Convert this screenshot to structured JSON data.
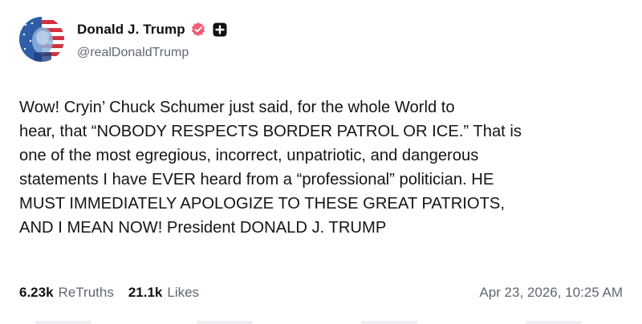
{
  "author": {
    "display_name": "Donald J. Trump",
    "handle": "@realDonaldTrump",
    "verified_icon": "verified-badge-icon",
    "plus_icon": "plus-square-icon",
    "accent_color": "#f25b72"
  },
  "post": {
    "text": "Wow! Cryin’ Chuck Schumer just said, for the whole World to\nhear, that “NOBODY RESPECTS BORDER PATROL OR ICE.” That is\none of the most egregious, incorrect, unpatriotic, and dangerous\nstatements I have EVER heard from a “professional” politician. HE\nMUST IMMEDIATELY APOLOGIZE TO THESE GREAT PATRIOTS,\nAND I MEAN NOW! President DONALD J. TRUMP"
  },
  "stats": {
    "retruths_count": "6.23k",
    "retruths_label": "ReTruths",
    "likes_count": "21.1k",
    "likes_label": "Likes"
  },
  "timestamp": "Apr 23, 2026, 10:25 AM"
}
